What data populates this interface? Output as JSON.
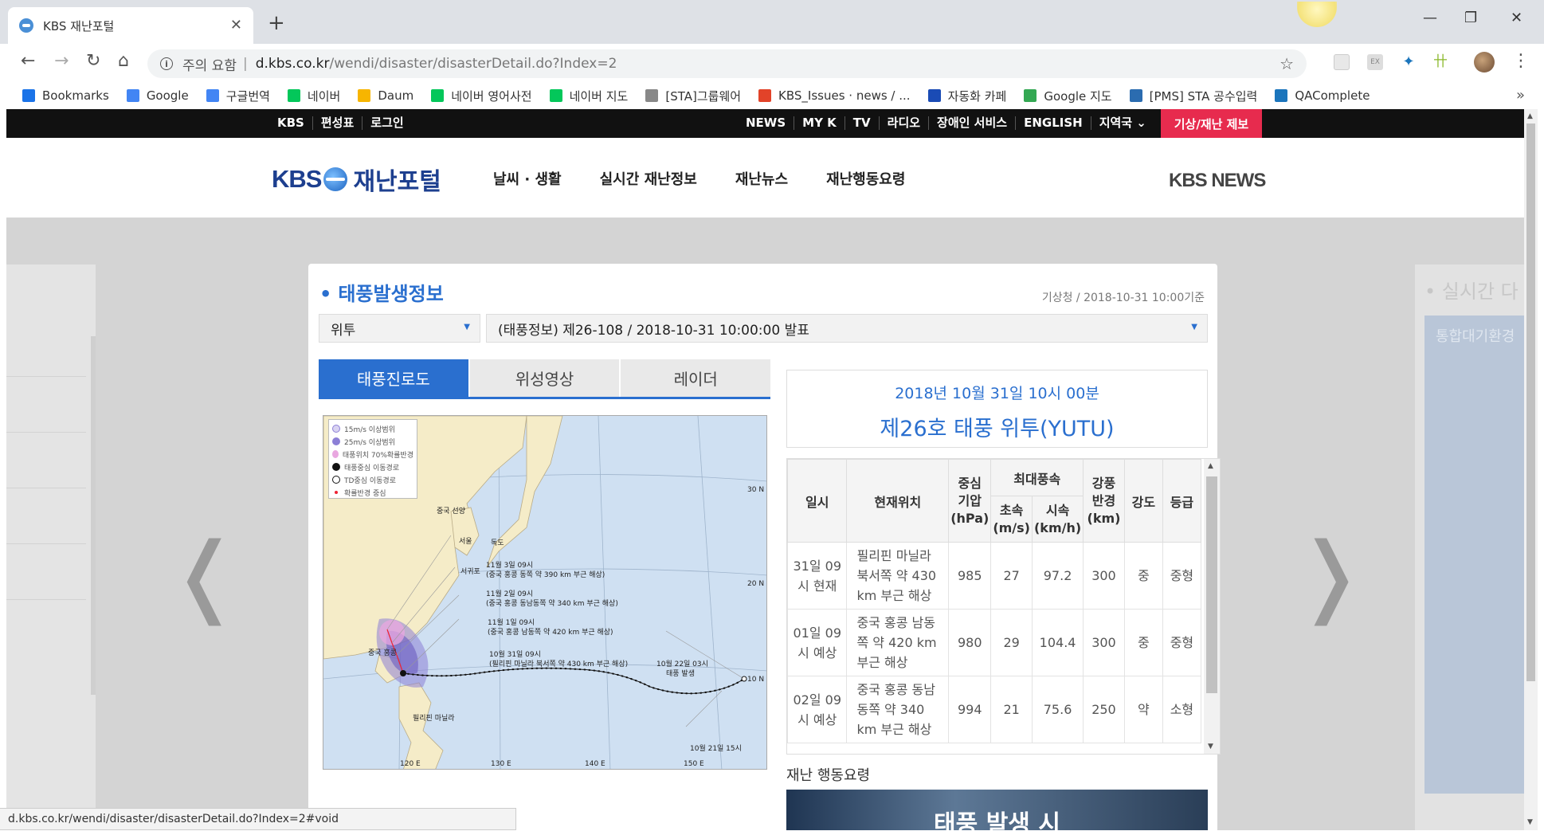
{
  "browser": {
    "tab_title": "KBS 재난포털",
    "url_warning": "주의 요함",
    "url_sep": "|",
    "url_host": "d.kbs.co.kr",
    "url_path": "/wendi/disaster/disasterDetail.do?Index=2",
    "bookmarks": [
      {
        "label": "Bookmarks",
        "icon": "star-icon",
        "color": "#1a73e8"
      },
      {
        "label": "Google",
        "icon": "google-icon",
        "color": "#4285f4"
      },
      {
        "label": "구글번역",
        "icon": "translate-icon",
        "color": "#4285f4"
      },
      {
        "label": "네이버",
        "icon": "naver-icon",
        "color": "#03c75a"
      },
      {
        "label": "Daum",
        "icon": "daum-icon",
        "color": "#f7b500"
      },
      {
        "label": "네이버 영어사전",
        "icon": "naver-dict-icon",
        "color": "#03c75a"
      },
      {
        "label": "네이버 지도",
        "icon": "naver-icon",
        "color": "#03c75a"
      },
      {
        "label": "[STA]그룹웨어",
        "icon": "page-icon",
        "color": "#888888"
      },
      {
        "label": "KBS_Issues · news / ...",
        "icon": "gitlab-icon",
        "color": "#e24329"
      },
      {
        "label": "자동화 카페",
        "icon": "stp-icon",
        "color": "#1a4bb5"
      },
      {
        "label": "Google 지도",
        "icon": "maps-icon",
        "color": "#34a853"
      },
      {
        "label": "[PMS] STA 공수입력",
        "icon": "pms-icon",
        "color": "#2b6cb0"
      },
      {
        "label": "QAComplete",
        "icon": "qa-icon",
        "color": "#1b75bc"
      }
    ],
    "status_url": "d.kbs.co.kr/wendi/disaster/disasterDetail.do?Index=2#void"
  },
  "topbar": {
    "left": [
      "KBS",
      "편성표",
      "로그인"
    ],
    "right": [
      "NEWS",
      "MY K",
      "TV",
      "라디오",
      "장애인 서비스",
      "ENGLISH",
      "지역국 ⌄"
    ],
    "report": "기상/재난 제보",
    "report_color": "#e72b4e"
  },
  "header": {
    "logo_kbs": "KBS",
    "logo_name": "재난포털",
    "nav": [
      "날씨 · 생활",
      "실시간 재난정보",
      "재난뉴스",
      "재난행동요령"
    ],
    "news_logo": "KBS NEWS"
  },
  "side": {
    "right_title": "• 실시간 다",
    "right_sub": "통합대기환경"
  },
  "panel": {
    "title": "태풍발생정보",
    "source": "기상청 / 2018-10-31 10:00기준",
    "select_name": "위투",
    "select_report": "(태풍정보) 제26-108 / 2018-10-31 10:00:00 발표",
    "tabs": [
      "태풍진로도",
      "위성영상",
      "레이더"
    ],
    "accent": "#2a6fcf",
    "legend": [
      "15m/s 이상범위",
      "25m/s 이상범위",
      "태풍위치 70%확률반경",
      "태풍중심 이동경로",
      "TD중심 이동경로",
      "확률반경 중심"
    ],
    "map_labels": {
      "cn": "중국 선양",
      "seoul": "서울",
      "dokdo": "독도",
      "seoguipo": "서귀포",
      "nov3": "11월 3일 09시",
      "nov3d": "(중국 홍콩 동쪽 약 390 km 부근 해상)",
      "nov2": "11월 2일 09시",
      "nov2d": "(중국 홍콩 동남동쪽 약 340 km 부근 해상)",
      "nov1": "11월 1일 09시",
      "nov1d": "(중국 홍콩 남동쪽 약 420 km 부근 해상)",
      "oct31": "10월 31일 09시",
      "oct31d": "(필리핀 마닐라 북서쪽 약 430 km 부근 해상)",
      "oct22": "10월 22일 03시",
      "oct22d": "태풍 발생",
      "oct21": "10월 21일 15시",
      "hk": "중국 홍콩",
      "manila": "필리핀 마닐라",
      "lat30": "30 N",
      "lat20": "20 N",
      "lat10": "10 N",
      "lon120": "120 E",
      "lon130": "130 E",
      "lon140": "140 E",
      "lon150": "150 E"
    },
    "info_date": "2018년 10월 31일 10시 00분",
    "info_name": "제26호 태풍 위투(YUTU)",
    "table": {
      "headers": {
        "time": "일시",
        "loc": "현재위치",
        "pressure": "중심 기압 (hPa)",
        "maxwind": "최대풍속",
        "ms": "초속 (m/s)",
        "kmh": "시속 (km/h)",
        "radius": "강풍 반경 (km)",
        "strength": "강도",
        "grade": "등급"
      },
      "rows": [
        {
          "time": "31일 09시 현재",
          "loc": "필리핀 마닐라 북서쪽 약 430 km 부근 해상",
          "pressure": "985",
          "ms": "27",
          "kmh": "97.2",
          "radius": "300",
          "strength": "중",
          "grade": "중형"
        },
        {
          "time": "01일 09시 예상",
          "loc": "중국 홍콩 남동쪽 약 420 km 부근 해상",
          "pressure": "980",
          "ms": "29",
          "kmh": "104.4",
          "radius": "300",
          "strength": "중",
          "grade": "중형"
        },
        {
          "time": "02일 09시 예상",
          "loc": "중국 홍콩 동남동쪽 약 340 km 부근 해상",
          "pressure": "994",
          "ms": "21",
          "kmh": "75.6",
          "radius": "250",
          "strength": "약",
          "grade": "소형"
        }
      ]
    },
    "action_label": "재난 행동요령",
    "action_banner": "태풍 발생 시"
  }
}
